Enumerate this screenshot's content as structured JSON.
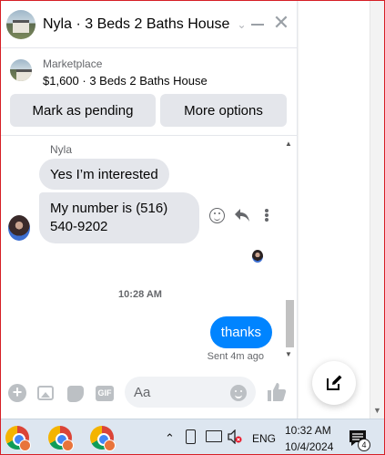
{
  "chat": {
    "title": "Nyla · 3 Beds 2 Baths House",
    "listing": {
      "source": "Marketplace",
      "price_title": "$1,600 · 3 Beds 2 Baths House"
    },
    "actions": {
      "mark_pending": "Mark as pending",
      "more_options": "More options"
    },
    "messages": {
      "sender_name": "Nyla",
      "incoming": [
        "Yes I’m interested",
        "My number is (516) 540-9202"
      ],
      "timestamp": "10:28 AM",
      "outgoing": "thanks",
      "sent_status": "Sent 4m ago"
    },
    "composer": {
      "placeholder": "Aa",
      "gif_label": "GIF"
    }
  },
  "taskbar": {
    "language": "ENG",
    "time": "10:32 AM",
    "date": "10/4/2024",
    "notification_count": "4"
  },
  "colors": {
    "accent": "#0084ff",
    "bubble_in": "#e4e6eb",
    "muted_text": "#65676b",
    "taskbar": "#dde6f0"
  }
}
